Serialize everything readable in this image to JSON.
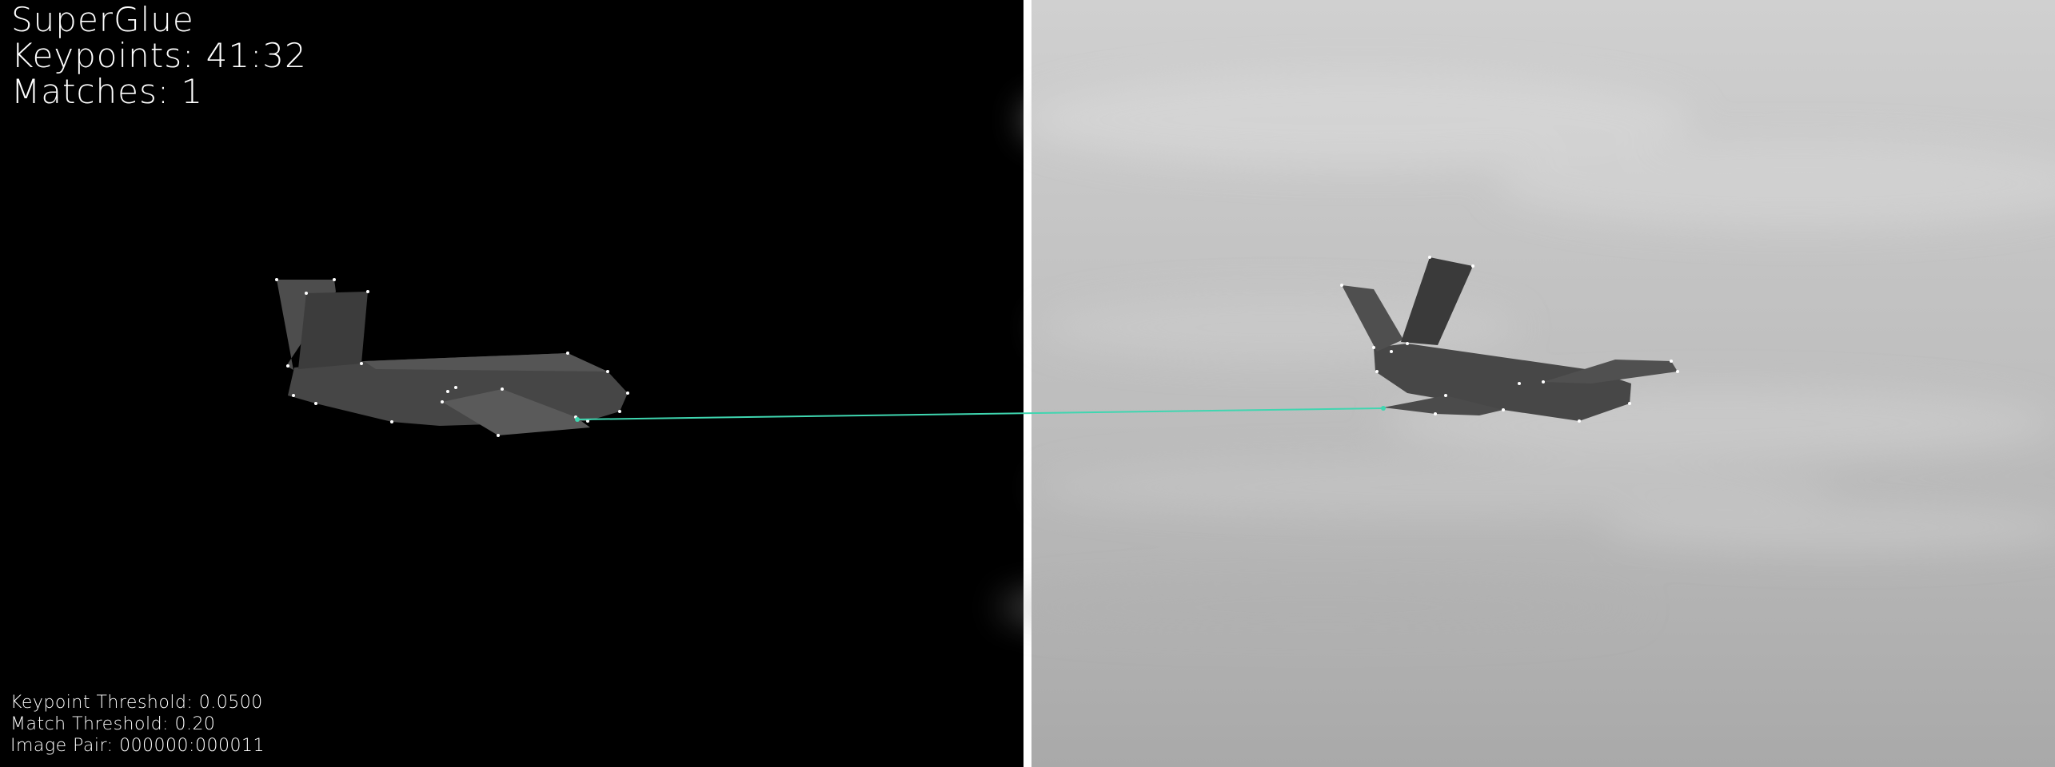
{
  "title": "SuperGlue",
  "keypoints_label": "Keypoints: 41:32",
  "matches_label": "Matches: 1",
  "keypoint_threshold_label": "Keypoint Threshold: 0.0500",
  "match_threshold_label": "Match Threshold: 0.20",
  "image_pair_label": "Image Pair: 000000:000011",
  "colors": {
    "left_background": "#000000",
    "separator": "#ffffff",
    "match_line": "#3fd6b0",
    "keypoint": "#ffffff",
    "aircraft": "#4a4a4a",
    "sky": "#c4c4c4"
  }
}
